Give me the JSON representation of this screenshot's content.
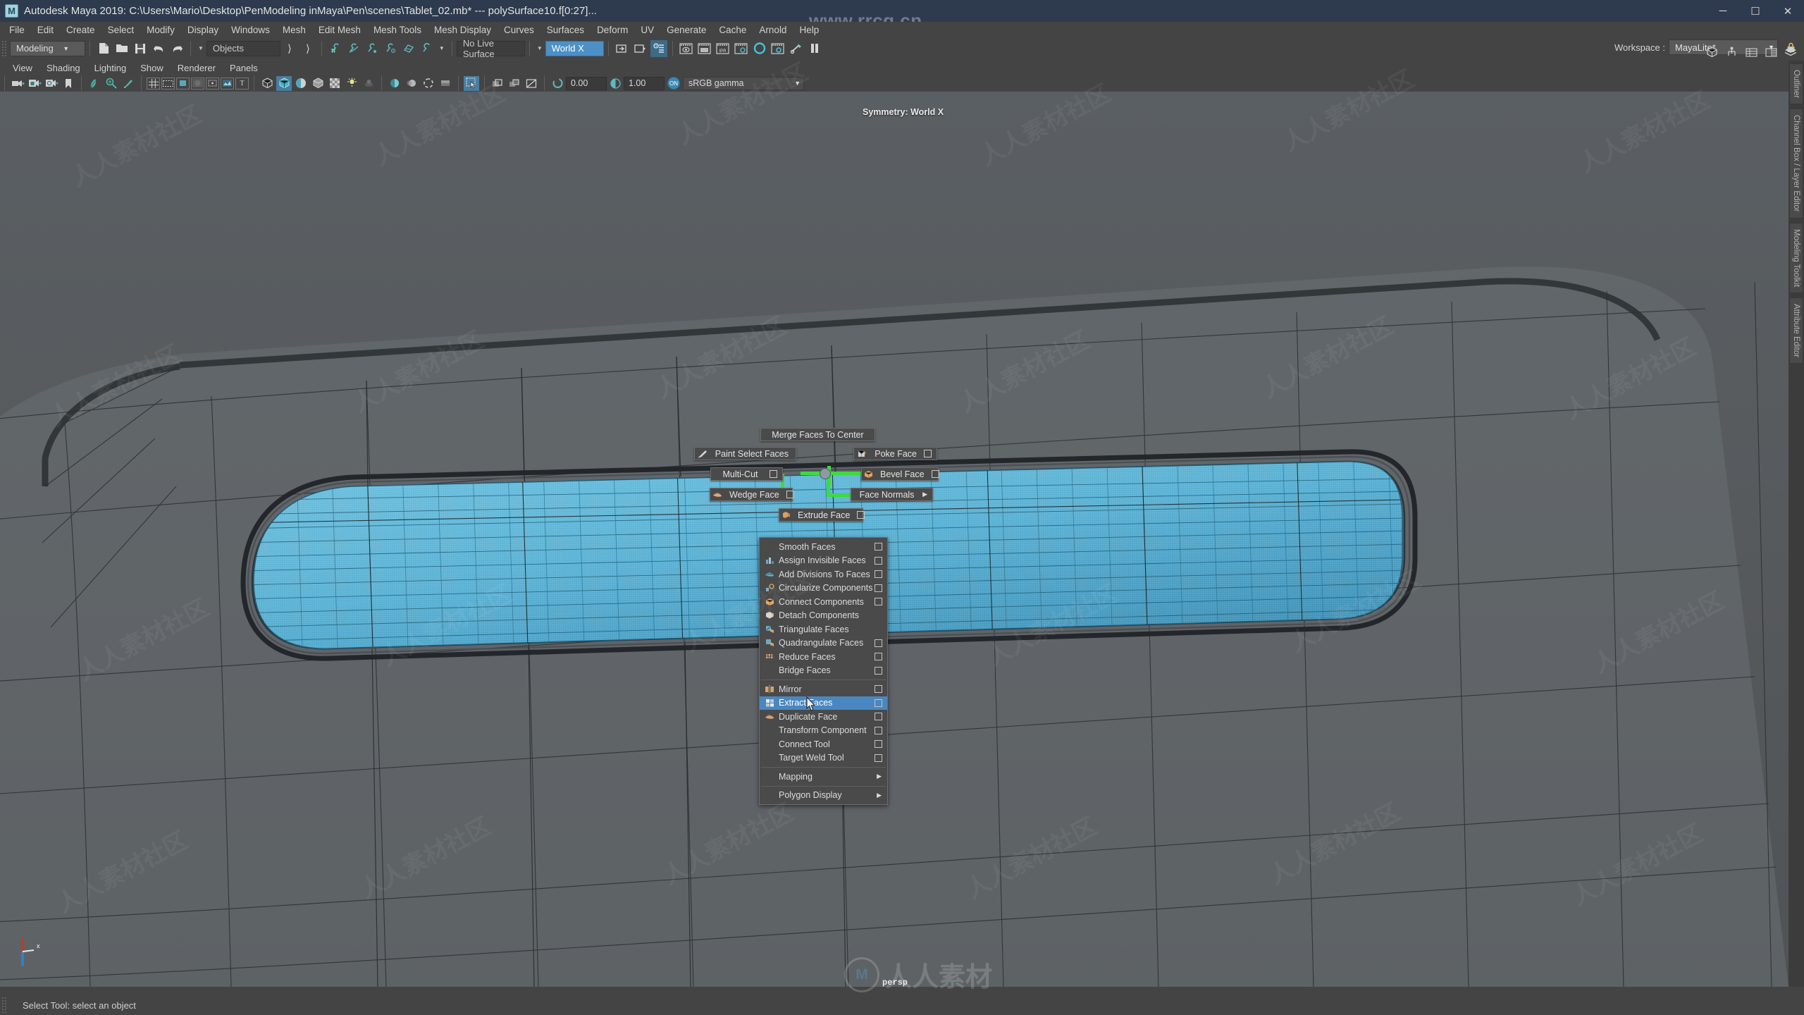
{
  "window": {
    "app_icon": "M",
    "title": "Autodesk Maya 2019: C:\\Users\\Mario\\Desktop\\PenModeling inMaya\\Pen\\scenes\\Tablet_02.mb*   ---   polySurface10.f[0:27]...",
    "minimize": "─",
    "maximize": "☐",
    "close": "✕",
    "site_watermark": "www.rrcg.cn"
  },
  "menubar": {
    "items": [
      "File",
      "Edit",
      "Create",
      "Select",
      "Modify",
      "Display",
      "Windows",
      "Mesh",
      "Edit Mesh",
      "Mesh Tools",
      "Mesh Display",
      "Curves",
      "Surfaces",
      "Deform",
      "UV",
      "Generate",
      "Cache",
      "Arnold",
      "Help"
    ]
  },
  "statusline": {
    "menuset": "Modeling",
    "file_icons": [
      "new-scene-icon",
      "open-scene-icon",
      "save-scene-icon",
      "undo-icon",
      "redo-icon"
    ],
    "selection_mask": "Objects",
    "snap_icons": [
      "snap-to-grid-icon",
      "snap-to-curve-icon",
      "snap-to-point-icon",
      "snap-to-projected-center-icon",
      "snap-to-view-plane-icon",
      "make-live-icon"
    ],
    "live_surface": "No Live Surface",
    "symmetry_value": "World X",
    "history_icons": [
      "input-connections-icon",
      "output-connections-icon",
      "construction-history-icon"
    ],
    "render_icons": [
      "render-current-frame-icon",
      "render-sequence-icon",
      "ipr-render-icon",
      "render-settings-icon",
      "hypershade-icon",
      "render-view-icon",
      "render-setup-icon",
      "pause-render-icon"
    ],
    "ipr_label": "IPR",
    "workspace_label": "Workspace :",
    "workspace_value": "MayaLite*",
    "workspace_lock": "lock-icon",
    "right_icons": [
      "show-hide-modeling-toolkit-icon",
      "show-hide-hypergraph-icon",
      "show-hide-channel-box-icon",
      "show-hide-attribute-editor-icon",
      "show-hide-layer-editor-icon"
    ]
  },
  "panelmenu": {
    "items": [
      "View",
      "Shading",
      "Lighting",
      "Show",
      "Renderer",
      "Panels"
    ]
  },
  "viewtoolbar": {
    "group1": [
      "select-camera-icon",
      "lock-camera-icon",
      "camera-attributes-icon",
      "bookmark-icon"
    ],
    "group2": [
      "image-plane-icon",
      "two-d-pan-zoom-icon",
      "oil-paint-icon"
    ],
    "group3": [
      "grid-icon",
      "film-gate-icon",
      "resolution-gate-icon",
      "gate-mask-icon",
      "film-origin-icon",
      "exposure-icon",
      "text-overlay-icon"
    ],
    "group4": [
      "wireframe-icon",
      "smooth-shade-all-icon",
      "smooth-shade-selected-icon",
      "flat-shade-icon",
      "use-default-material-icon",
      "shaded-lighting-icon",
      "wireframe-on-shaded-icon"
    ],
    "group5": [
      "light-icon",
      "shadows-icon",
      "screen-space-ao-icon",
      "motion-blur-icon",
      "multisample-icon"
    ],
    "group6": [
      "isolate-select-icon"
    ],
    "group7": [
      "xray-icon",
      "xray-joints-icon",
      "xray-active-components-icon"
    ],
    "exposure_value": "0.00",
    "gamma_value": "1.00",
    "color_toggle": "ON",
    "color_management": "sRGB gamma"
  },
  "viewport": {
    "symmetry_overlay": "Symmetry: World X",
    "camera_name": "persp",
    "axis_x": "x"
  },
  "right_tabs": {
    "items": [
      "Outliner",
      "Channel Box / Layer Editor",
      "Modeling Toolkit",
      "Attribute Editor"
    ]
  },
  "marking_menu": {
    "north": {
      "label": "Merge Faces To Center",
      "icon": "",
      "option_box": false
    },
    "nw": {
      "label": "Paint Select Faces",
      "icon": "paint-select-icon",
      "option_box": false
    },
    "ne": {
      "label": "Poke Face",
      "icon": "poke-face-icon",
      "option_box": true
    },
    "west": {
      "label": "Multi-Cut",
      "icon": "",
      "option_box": true
    },
    "east": {
      "label": "Bevel Face",
      "icon": "bevel-face-icon",
      "option_box": true
    },
    "sw": {
      "label": "Wedge Face",
      "icon": "wedge-face-icon",
      "option_box": true
    },
    "se": {
      "label": "Face Normals",
      "icon": "",
      "submenu": true
    },
    "south": {
      "label": "Extrude Face",
      "icon": "extrude-face-icon",
      "option_box": true
    }
  },
  "dropdown": {
    "items": [
      {
        "label": "Smooth Faces",
        "icon": "",
        "option_box": true,
        "submenu": false,
        "active": false
      },
      {
        "label": "Assign Invisible Faces",
        "icon": "assign-invisible-faces-icon",
        "option_box": true,
        "submenu": false,
        "active": false
      },
      {
        "label": "Add Divisions To Faces",
        "icon": "add-divisions-icon",
        "option_box": true,
        "submenu": false,
        "active": false
      },
      {
        "label": "Circularize Components",
        "icon": "circularize-icon",
        "option_box": true,
        "submenu": false,
        "active": false
      },
      {
        "label": "Connect Components",
        "icon": "connect-components-icon",
        "option_box": true,
        "submenu": false,
        "active": false
      },
      {
        "label": "Detach Components",
        "icon": "detach-components-icon",
        "option_box": false,
        "submenu": false,
        "active": false
      },
      {
        "label": "Triangulate Faces",
        "icon": "triangulate-icon",
        "option_box": false,
        "submenu": false,
        "active": false
      },
      {
        "label": "Quadrangulate Faces",
        "icon": "quadrangulate-icon",
        "option_box": true,
        "submenu": false,
        "active": false
      },
      {
        "label": "Reduce Faces",
        "icon": "reduce-faces-icon",
        "option_box": true,
        "submenu": false,
        "active": false
      },
      {
        "label": "Bridge Faces",
        "icon": "",
        "option_box": true,
        "submenu": false,
        "active": false
      },
      {
        "sep": true
      },
      {
        "label": "Mirror",
        "icon": "mirror-icon",
        "option_box": true,
        "submenu": false,
        "active": false
      },
      {
        "label": "Extract Faces",
        "icon": "extract-faces-icon",
        "option_box": true,
        "submenu": false,
        "active": true
      },
      {
        "label": "Duplicate Face",
        "icon": "duplicate-face-icon",
        "option_box": true,
        "submenu": false,
        "active": false
      },
      {
        "label": "Transform Component",
        "icon": "",
        "option_box": true,
        "submenu": false,
        "active": false
      },
      {
        "label": "Connect Tool",
        "icon": "",
        "option_box": true,
        "submenu": false,
        "active": false
      },
      {
        "label": "Target Weld Tool",
        "icon": "",
        "option_box": true,
        "submenu": false,
        "active": false
      },
      {
        "sep": true
      },
      {
        "label": "Mapping",
        "icon": "",
        "option_box": false,
        "submenu": true,
        "active": false
      },
      {
        "sep": true
      },
      {
        "label": "Polygon Display",
        "icon": "",
        "option_box": false,
        "submenu": true,
        "active": false
      }
    ]
  },
  "statusbar": {
    "message": "Select Tool: select an object"
  },
  "watermarks": {
    "tile_text": "人人素材社区",
    "bottom_text": "人人素材",
    "bottom_logo": "M"
  },
  "colors": {
    "accent_blue": "#4c90c6",
    "selected_face": "#5cb3d6",
    "marking_green": "#3ddb3d",
    "titlebar": "#2e3b4e",
    "chrome": "#444444",
    "viewport_bg": "#555a5d"
  }
}
